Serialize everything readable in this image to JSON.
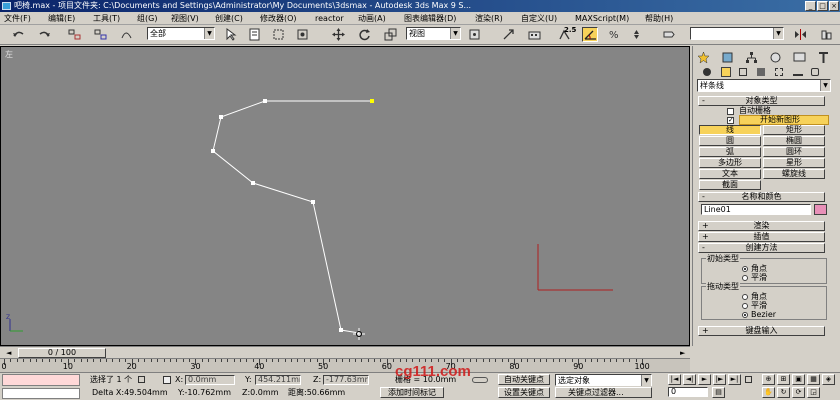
{
  "window": {
    "title": "吧椅.max - 项目文件夹: C:\\Documents and Settings\\Administrator\\My Documents\\3dsmax - Autodesk 3ds Max 9 S..."
  },
  "menu": [
    "文件(F)",
    "编辑(E)",
    "工具(T)",
    "组(G)",
    "视图(V)",
    "创建(C)",
    "修改器(O)",
    "reactor",
    "动画(A)",
    "图表编辑器(D)",
    "渲染(R)",
    "自定义(U)",
    "MAXScript(M)",
    "帮助(H)"
  ],
  "toolbar": {
    "selection_filter": "全部",
    "reference_coord": "视图",
    "snap_value": "2.5"
  },
  "viewport": {
    "label": "左",
    "spline_color": "#ffffff",
    "selected_vertex_color": "#ffff00"
  },
  "command_panel": {
    "category_dropdown": "样条线",
    "object_type": {
      "header": "对象类型",
      "autogrid": "自动栅格",
      "start_new_shape": "开始新图形",
      "buttons": [
        "线",
        "矩形",
        "圆",
        "椭圆",
        "弧",
        "圆环",
        "多边形",
        "星形",
        "文本",
        "螺旋线",
        "截面"
      ]
    },
    "name_color": {
      "header": "名称和颜色",
      "object_name": "Line01",
      "swatch_color": "#e890b8"
    },
    "rollouts": {
      "rendering": "渲染",
      "interpolation": "插值",
      "creation_method": "创建方法",
      "keyboard_entry": "键盘输入"
    },
    "initial_type": {
      "label": "初始类型",
      "options": [
        "角点",
        "平滑"
      ],
      "selected": "角点"
    },
    "drag_type": {
      "label": "拖动类型",
      "options": [
        "角点",
        "平滑",
        "Bezier"
      ],
      "selected": "Bezier"
    }
  },
  "time_slider": {
    "label": "0 / 100",
    "current": 0,
    "total": 100
  },
  "ruler": {
    "ticks": [
      "0",
      "10",
      "20",
      "30",
      "40",
      "50",
      "60",
      "70",
      "80",
      "90",
      "100"
    ]
  },
  "status": {
    "selection": "选择了 1 个",
    "x_label": "X:",
    "x_value": "0.0mm",
    "y_label": "Y:",
    "y_value": "454.211mm",
    "z_label": "Z:",
    "z_value": "-177.63mm",
    "grid": "栅格 = 10.0mm",
    "auto_key": "自动关键点",
    "key_filter_select": "选定对象",
    "set_key": "设置关键点",
    "key_filters": "关键点过滤器...",
    "frame_value": "0",
    "delta": "Delta X:49.504mm",
    "delta_y": "Y:-10.762mm",
    "delta_z": "Z:0.0mm",
    "distance": "距离:50.66mm",
    "add_time_tag": "添加时间标记",
    "watermark": "cg111.com"
  }
}
